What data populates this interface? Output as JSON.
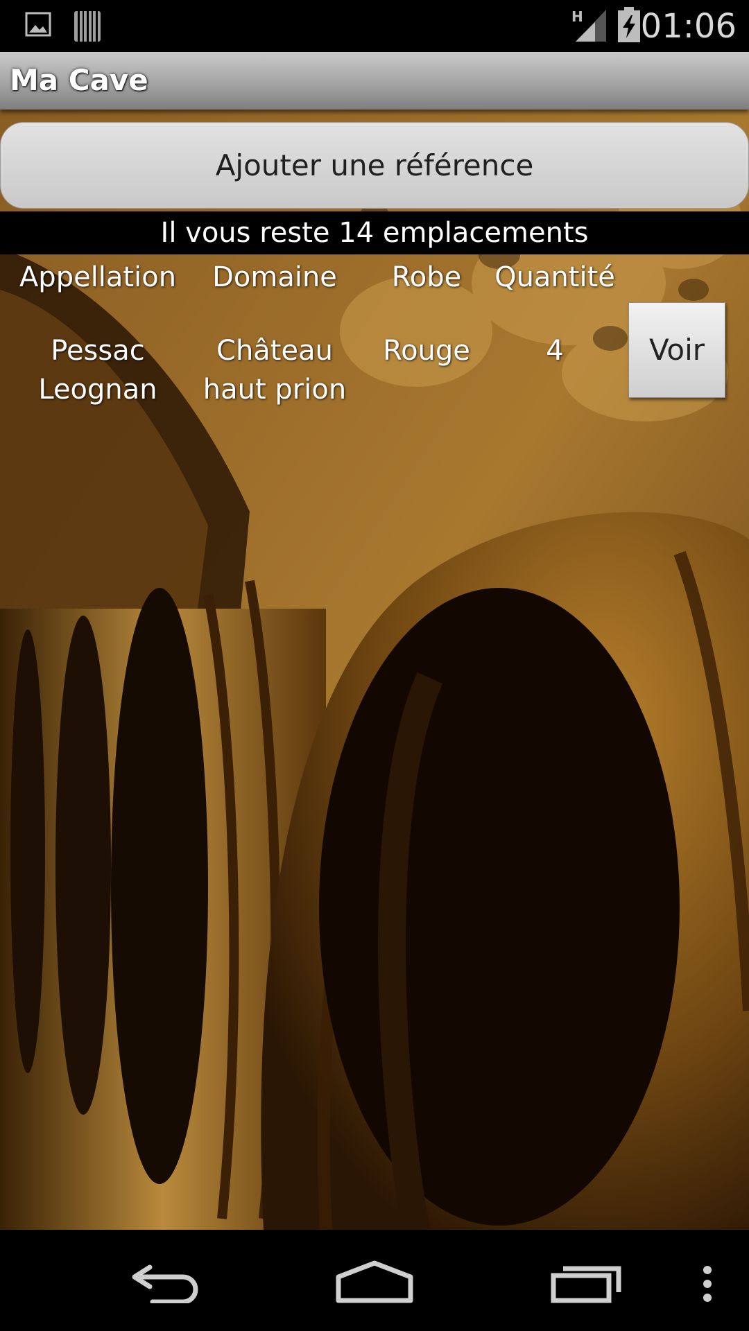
{
  "status_bar": {
    "time": "01:06",
    "network_type": "H",
    "icons": [
      "gallery-icon",
      "barcode-icon",
      "signal-icon",
      "battery-charging-icon"
    ]
  },
  "action_bar": {
    "title": "Ma Cave"
  },
  "main": {
    "add_button_label": "Ajouter une référence",
    "remaining_text": "Il vous reste 14 emplacements",
    "table": {
      "headers": [
        "Appellation",
        "Domaine",
        "Robe",
        "Quantité"
      ],
      "rows": [
        {
          "appellation": "Pessac\nLeognan",
          "domaine": "Château\nhaut prion",
          "robe": "Rouge",
          "quantite": "4",
          "action_label": "Voir"
        }
      ]
    }
  },
  "nav_bar": {
    "buttons": [
      "back-icon",
      "home-icon",
      "recent-apps-icon",
      "overflow-menu-icon"
    ]
  },
  "colors": {
    "status_bar_bg": "#000000",
    "action_bar_bg": "#a4a4a4",
    "button_bg": "#d5d5d5",
    "cellar_wood": "#7a4a14"
  }
}
